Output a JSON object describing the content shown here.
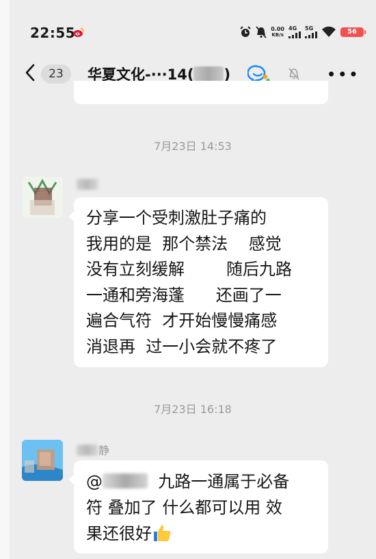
{
  "status_bar": {
    "time": "22:55",
    "net_speed_value": "0.00",
    "net_speed_unit": "KB/s",
    "signal1": "4G",
    "signal2": "5G",
    "battery": "56"
  },
  "nav": {
    "unread_count": "23",
    "title_prefix": "华夏文化-···14(",
    "title_suffix": ")"
  },
  "messages": [
    {
      "timestamp": "7月23日 14:53",
      "sender_name_visible": "",
      "lines": [
        "分享一个受刺激肚子痛的",
        "我用的是  那个禁法    感觉",
        "没有立刻缓解        随后九路",
        "一通和旁海蓬      还画了一",
        "遍合气符  才开始慢慢痛感",
        "消退再  过一小会就不疼了"
      ]
    },
    {
      "timestamp": "7月23日 16:18",
      "sender_name_visible": "静",
      "mention_prefix": "@",
      "lines_first": "  九路一通属于必备",
      "lines": [
        "符 叠加了 什么都可以用 效",
        "果还很好"
      ]
    }
  ],
  "colors": {
    "background": "#ededed",
    "bubble": "#ffffff",
    "battery": "#f05252",
    "timestamp": "#9a9a9a"
  },
  "icons": [
    "weibo-icon",
    "alarm-icon",
    "mute-status-icon",
    "signal-icon",
    "wifi-icon",
    "back-icon",
    "group-chat-icon",
    "mute-icon",
    "more-icon",
    "thumbs-up-icon"
  ]
}
